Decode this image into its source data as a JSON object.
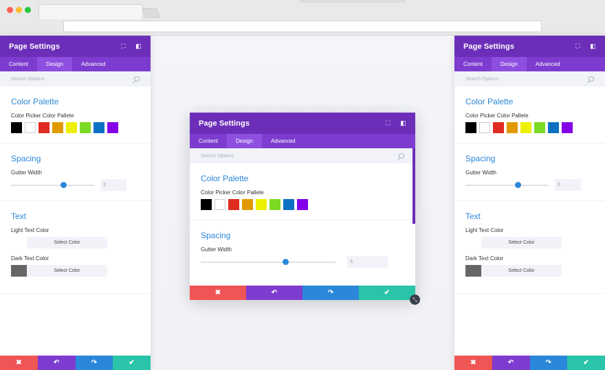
{
  "panel": {
    "title": "Page Settings",
    "tabs": [
      "Content",
      "Design",
      "Advanced"
    ],
    "search_placeholder": "Search Options",
    "color_palette": {
      "title": "Color Palette",
      "label": "Color Picker Color Pallete",
      "swatches": [
        "#000000",
        "#ffffff",
        "#e02b20",
        "#e09900",
        "#edf000",
        "#7cda24",
        "#0c71c3",
        "#8300e9"
      ]
    },
    "spacing": {
      "title": "Spacing",
      "label": "Gutter Width",
      "value": "3",
      "slider_fraction": 0.63
    },
    "text": {
      "title": "Text",
      "light_label": "Light Text Color",
      "dark_label": "Dark Text Color",
      "select_label": "Select Color",
      "light_chip": "#ffffff",
      "dark_chip": "#666666"
    },
    "footer": {
      "cancel": "✖",
      "undo": "↶",
      "redo": "↷",
      "save": "✔"
    }
  },
  "icons": [
    "expand-icon",
    "sidebar-icon",
    "search-icon",
    "resize-icon"
  ],
  "colors": {
    "header": "#6c2eb9",
    "tabs": "#7d3ccf",
    "accent": "#2b87da",
    "cancel": "#ef5555",
    "save": "#29c4a9"
  }
}
